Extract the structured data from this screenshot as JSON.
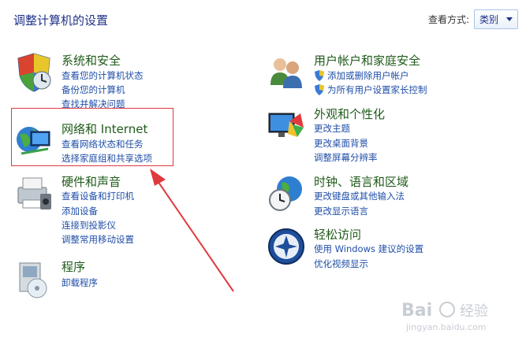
{
  "header": {
    "title": "调整计算机的设置",
    "view_by_label": "查看方式:",
    "view_by_value": "类别"
  },
  "left_categories": [
    {
      "title": "系统和安全",
      "links": [
        "查看您的计算机状态",
        "备份您的计算机",
        "查找并解决问题"
      ]
    },
    {
      "title": "网络和 Internet",
      "links": [
        "查看网络状态和任务",
        "选择家庭组和共享选项"
      ]
    },
    {
      "title": "硬件和声音",
      "links": [
        "查看设备和打印机",
        "添加设备",
        "连接到投影仪",
        "调整常用移动设置"
      ]
    },
    {
      "title": "程序",
      "links": [
        "卸载程序"
      ]
    }
  ],
  "right_categories": [
    {
      "title": "用户帐户和家庭安全",
      "links": [
        "添加或删除用户帐户",
        "为所有用户设置家长控制"
      ]
    },
    {
      "title": "外观和个性化",
      "links": [
        "更改主题",
        "更改桌面背景",
        "调整屏幕分辨率"
      ]
    },
    {
      "title": "时钟、语言和区域",
      "links": [
        "更改键盘或其他输入法",
        "更改显示语言"
      ]
    },
    {
      "title": "轻松访问",
      "links": [
        "使用 Windows 建议的设置",
        "优化视频显示"
      ]
    }
  ],
  "watermark": {
    "brand": "Bai",
    "brand2": "经验",
    "url": "jingyan.baidu.com"
  },
  "colors": {
    "title_green": "#1f5b1a",
    "link_blue": "#1f4ea8",
    "highlight_red": "#e0393e"
  }
}
